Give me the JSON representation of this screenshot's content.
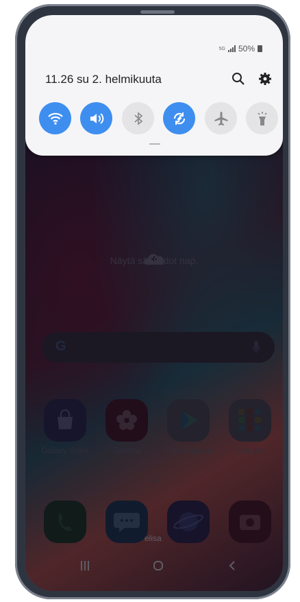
{
  "status_bar": {
    "network_small": "5G",
    "battery_text": "50%"
  },
  "quick_panel": {
    "datetime": "11.26  su 2. helmikuuta",
    "toggles": [
      {
        "name": "wifi",
        "state": "on"
      },
      {
        "name": "sound",
        "state": "on"
      },
      {
        "name": "bluetooth",
        "state": "off"
      },
      {
        "name": "auto-rotate",
        "state": "on"
      },
      {
        "name": "airplane-mode",
        "state": "off"
      },
      {
        "name": "flashlight",
        "state": "off"
      }
    ]
  },
  "home": {
    "weather_text": "Näytä säätiedot nap.",
    "search_logo": "G",
    "apps": [
      {
        "label": "Galaxy Store",
        "color": "#2c3a8f"
      },
      {
        "label": "Galleria",
        "color": "#b8214a"
      },
      {
        "label": "Play Kauppa",
        "color": "#e8eaf0"
      },
      {
        "label": "Google",
        "color": "#f2f2f2"
      }
    ],
    "dock": [
      {
        "name": "phone",
        "color": "#2ca84a"
      },
      {
        "name": "messages",
        "color": "#2c88e0"
      },
      {
        "name": "internet",
        "color": "#5a4ed6"
      },
      {
        "name": "camera",
        "color": "#e8344c"
      }
    ],
    "carrier": "elisa"
  },
  "navbar": {
    "recents": "|||",
    "home": "O",
    "back": "<"
  },
  "colors": {
    "accent": "#3e8ef0",
    "panel_bg": "#f5f5f7"
  }
}
